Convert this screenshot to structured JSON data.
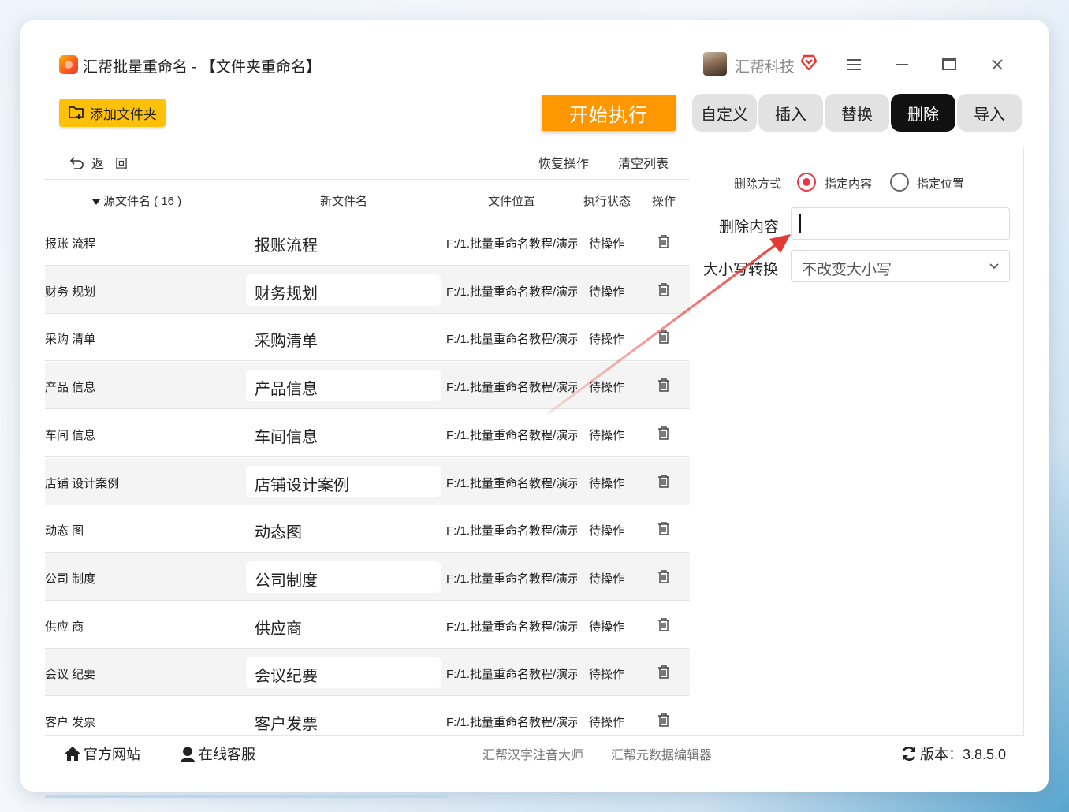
{
  "window": {
    "title": "汇帮批量重命名 - 【文件夹重命名】",
    "brand": "汇帮科技"
  },
  "toolbar": {
    "add_folder": "添加文件夹",
    "start": "开始执行",
    "tabs": [
      "自定义",
      "插入",
      "替换",
      "删除",
      "导入"
    ],
    "active_tab": "删除"
  },
  "list_controls": {
    "back": "返回",
    "restore": "恢复操作",
    "clear": "清空列表"
  },
  "table": {
    "headers": {
      "source": "源文件名 ( 16 )",
      "new_name": "新文件名",
      "location": "文件位置",
      "status": "执行状态",
      "action": "操作"
    },
    "rows": [
      {
        "source": "报账  流程",
        "new_name": "报账流程",
        "location": "F:/1.批量重命名教程/演示",
        "status": "待操作"
      },
      {
        "source": "财务  规划",
        "new_name": "财务规划",
        "location": "F:/1.批量重命名教程/演示",
        "status": "待操作"
      },
      {
        "source": "采购  清单",
        "new_name": "采购清单",
        "location": "F:/1.批量重命名教程/演示",
        "status": "待操作"
      },
      {
        "source": "产品  信息",
        "new_name": "产品信息",
        "location": "F:/1.批量重命名教程/演示",
        "status": "待操作"
      },
      {
        "source": "车间  信息",
        "new_name": "车间信息",
        "location": "F:/1.批量重命名教程/演示",
        "status": "待操作"
      },
      {
        "source": "店铺  设计案例",
        "new_name": "店铺设计案例",
        "location": "F:/1.批量重命名教程/演示",
        "status": "待操作"
      },
      {
        "source": "动态  图",
        "new_name": "动态图",
        "location": "F:/1.批量重命名教程/演示",
        "status": "待操作"
      },
      {
        "source": "公司  制度",
        "new_name": "公司制度",
        "location": "F:/1.批量重命名教程/演示",
        "status": "待操作"
      },
      {
        "source": "供应  商",
        "new_name": "供应商",
        "location": "F:/1.批量重命名教程/演示",
        "status": "待操作"
      },
      {
        "source": "会议  纪要",
        "new_name": "会议纪要",
        "location": "F:/1.批量重命名教程/演示",
        "status": "待操作"
      },
      {
        "source": "客户  发票",
        "new_name": "客户发票",
        "location": "F:/1.批量重命名教程/演示",
        "status": "待操作"
      }
    ]
  },
  "panel": {
    "delete_mode_label": "删除方式",
    "mode_options": [
      "指定内容",
      "指定位置"
    ],
    "selected_mode": "指定内容",
    "delete_content_label": "删除内容",
    "delete_content_value": "",
    "case_label": "大小写转换",
    "case_value": "不改变大小写"
  },
  "footer": {
    "website": "官方网站",
    "support": "在线客服",
    "link1": "汇帮汉字注音大师",
    "link2": "汇帮元数据编辑器",
    "version": "版本：3.8.5.0"
  },
  "colors": {
    "accent_orange": "#ff9800",
    "add_button_yellow": "#ffc107",
    "radio_red": "#e53946",
    "active_tab": "#111111",
    "annotation_arrow": "#e53935"
  },
  "icons": [
    "app-logo-icon",
    "vip-heart-icon",
    "menu-icon",
    "minimize-icon",
    "maximize-icon",
    "close-icon",
    "add-folder-icon",
    "back-arrow-icon",
    "trash-icon",
    "home-icon",
    "support-icon",
    "refresh-icon",
    "chevron-down-icon"
  ]
}
